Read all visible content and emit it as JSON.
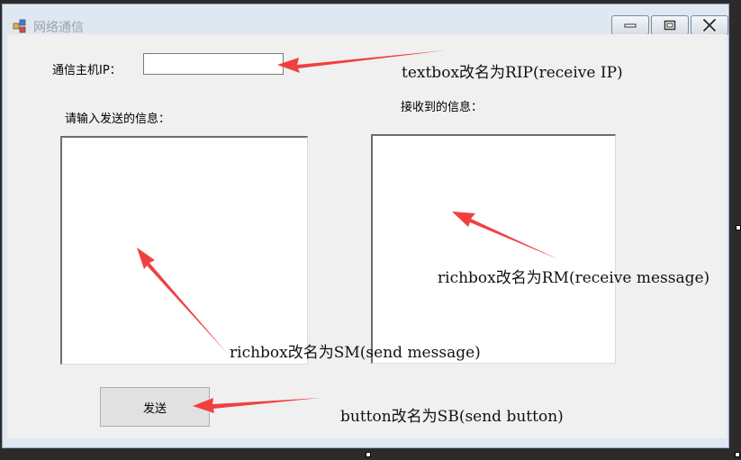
{
  "window": {
    "title": "网络通信"
  },
  "form": {
    "ip_label": "通信主机IP：",
    "ip_value": "",
    "send_label": "请输入发送的信息：",
    "receive_label": "接收到的信息：",
    "send_button": "发送"
  },
  "annotations": {
    "textbox_note": "textbox改名为RIP(receive IP)",
    "richbox_rm_note": "richbox改名为RM(receive message)",
    "richbox_sm_note": "richbox改名为SM(send message)",
    "button_note": "button改名为SB(send button)"
  },
  "icons": {
    "app": "app-icon",
    "minimize": "minimize-icon",
    "maximize": "maximize-icon",
    "close": "close-icon"
  },
  "colors": {
    "arrow": "#f04040",
    "client_bg": "#f0f0f0",
    "title_bar": "#dfe7f1"
  }
}
